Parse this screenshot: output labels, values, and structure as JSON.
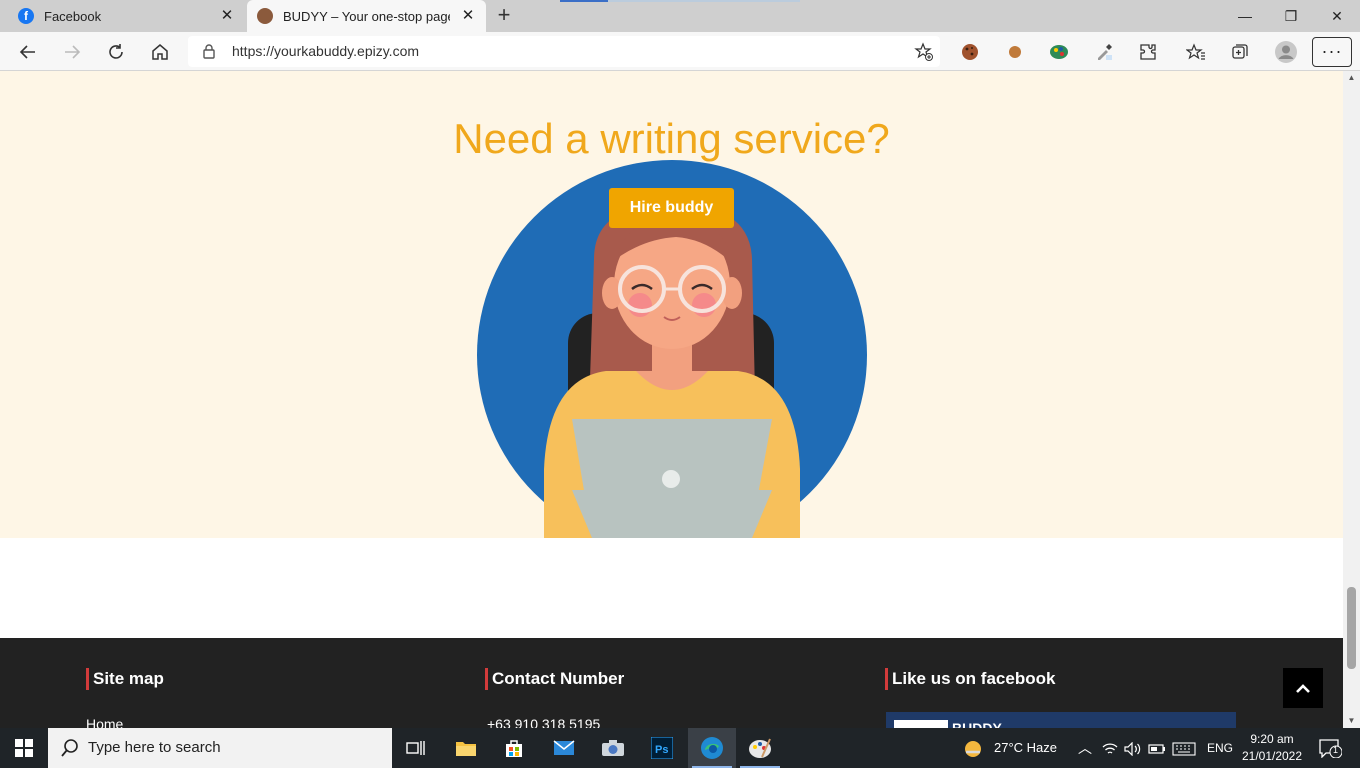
{
  "browser": {
    "tabs": [
      {
        "title": "Facebook"
      },
      {
        "title": "BUDYY – Your one-stop page for"
      }
    ],
    "address": {
      "url": "https://yourkabuddy.epizy.com"
    }
  },
  "page": {
    "hero": {
      "title": "Need a writing service?",
      "cta_label": "Hire buddy"
    },
    "footer": {
      "sitemap": {
        "title": "Site map",
        "first_item": "Home"
      },
      "contact": {
        "title": "Contact Number",
        "phone": "+63 910 318 5195"
      },
      "facebook": {
        "title": "Like us on facebook",
        "page_name": "BUDDY"
      }
    }
  },
  "taskbar": {
    "search_placeholder": "Type here to search",
    "weather": "27°C  Haze",
    "language": "ENG",
    "time": "9:20 am",
    "date": "21/01/2022",
    "notification_count": "1"
  },
  "colors": {
    "accent": "#f0a81c",
    "button": "#f0a500",
    "hero_bg": "#fef6e6",
    "footer_bg": "#222222",
    "circle": "#1f6cb6"
  }
}
